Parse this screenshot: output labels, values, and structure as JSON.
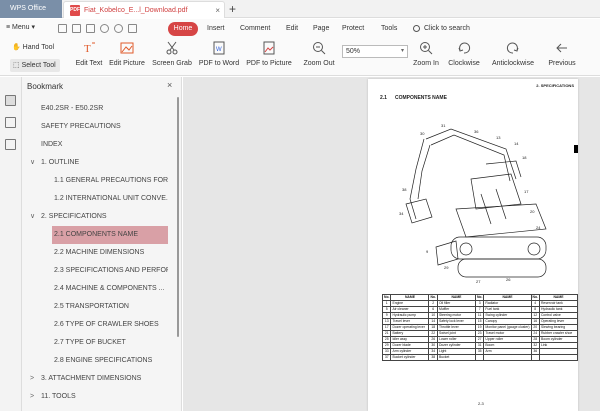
{
  "titlebar": {
    "app_tab": "WPS Office",
    "doc_tab": "Fiat_Kobelco_E...l_Download.pdf",
    "pdf_badge": "PDF",
    "close_glyph": "×",
    "new_tab_glyph": "+"
  },
  "menubar": {
    "menu_label": "≡ Menu ▾",
    "items": [
      "Home",
      "Insert",
      "Comment",
      "Edit",
      "Page",
      "Protect",
      "Tools"
    ],
    "search_label": "Click to search"
  },
  "toolbar": {
    "hand_tool": "Hand Tool",
    "select_tool": "Select Tool",
    "buttons": [
      "Edit Text",
      "Edit Picture",
      "Screen Grab",
      "PDF to Word",
      "PDF to Picture",
      "Zoom Out",
      "Zoom In",
      "Clockwise",
      "Anticlockwise",
      "Previous"
    ],
    "zoom_value": "50%",
    "zoom_arrow": "▾"
  },
  "bookmark": {
    "title": "Bookmark",
    "close_glyph": "×",
    "items": [
      {
        "label": "E40.2SR - E50.2SR",
        "level": 0,
        "chev": ""
      },
      {
        "label": "SAFETY PRECAUTIONS",
        "level": 0,
        "chev": ""
      },
      {
        "label": "INDEX",
        "level": 0,
        "chev": ""
      },
      {
        "label": "1. OUTLINE",
        "level": 0,
        "chev": "∨"
      },
      {
        "label": "1.1 GENERAL PRECAUTIONS FOR ...",
        "level": 1,
        "chev": ""
      },
      {
        "label": "1.2 INTERNATIONAL UNIT CONVE...",
        "level": 1,
        "chev": ""
      },
      {
        "label": "2. SPECIFICATIONS",
        "level": 0,
        "chev": "∨"
      },
      {
        "label": "2.1 COMPONENTS NAME",
        "level": 1,
        "chev": "",
        "active": true
      },
      {
        "label": "2.2 MACHINE DIMENSIONS",
        "level": 1,
        "chev": ""
      },
      {
        "label": "2.3 SPECIFICATIONS AND PERFOR...",
        "level": 1,
        "chev": ""
      },
      {
        "label": "2.4 MACHINE & COMPONENTS ...",
        "level": 1,
        "chev": ""
      },
      {
        "label": "2.5 TRANSPORTATION",
        "level": 1,
        "chev": ""
      },
      {
        "label": "2.6 TYPE OF CRAWLER SHOES",
        "level": 1,
        "chev": ""
      },
      {
        "label": "2.7 TYPE OF BUCKET",
        "level": 1,
        "chev": ""
      },
      {
        "label": "2.8 ENGINE SPECIFICATIONS",
        "level": 1,
        "chev": ""
      },
      {
        "label": "3. ATTACHMENT DIMENSIONS",
        "level": 0,
        "chev": ">"
      },
      {
        "label": "11. TOOLS",
        "level": 0,
        "chev": ">"
      }
    ]
  },
  "page": {
    "header": "2. SPECIFICATIONS",
    "section_no": "2.1",
    "section_title": "COMPONENTS NAME",
    "page_number": "2-3",
    "table_headers": [
      "No.",
      "NAME",
      "No.",
      "NAME",
      "No.",
      "NAME",
      "No.",
      "NAME"
    ],
    "table_rows": [
      [
        "1",
        "Engine",
        "2",
        "Oil filler",
        "3",
        "Radiator",
        "4",
        "Reservoir tank"
      ],
      [
        "5",
        "Air cleaner",
        "6",
        "Muffler",
        "7",
        "Fuel tank",
        "8",
        "Hydraulic tank"
      ],
      [
        "9",
        "Hydraulic pump",
        "10",
        "Steering motor",
        "11",
        "Swing cylinder",
        "12",
        "Control valve"
      ],
      [
        "13",
        "Travel lever",
        "14",
        "Safety lock lever",
        "15",
        "Canopy",
        "16",
        "Operating lever"
      ],
      [
        "17",
        "Dozer operating lever",
        "18",
        "Throttle lever",
        "19",
        "Monitor panel (gauge cluster)",
        "20",
        "Slewing bearing"
      ],
      [
        "21",
        "Battery",
        "22",
        "Swivel joint",
        "23",
        "Travel motor",
        "24",
        "Rubber crawler shoe"
      ],
      [
        "25",
        "Idler assy",
        "26",
        "Lower roller",
        "27",
        "Upper roller",
        "28",
        "Boom cylinder"
      ],
      [
        "29",
        "Dozer blade",
        "30",
        "Dozer cylinder",
        "31",
        "Boom",
        "32",
        "Link"
      ],
      [
        "33",
        "Arm cylinder",
        "34",
        "Light",
        "35",
        "Arm",
        "36",
        ""
      ],
      [
        "37",
        "Bucket cylinder",
        "38",
        "Bucket",
        "",
        "",
        "",
        ""
      ]
    ]
  },
  "colors": {
    "accent_red": "#d64545",
    "active_bookmark": "#d9a0a6",
    "wps_tab": "#7a8fa8"
  }
}
